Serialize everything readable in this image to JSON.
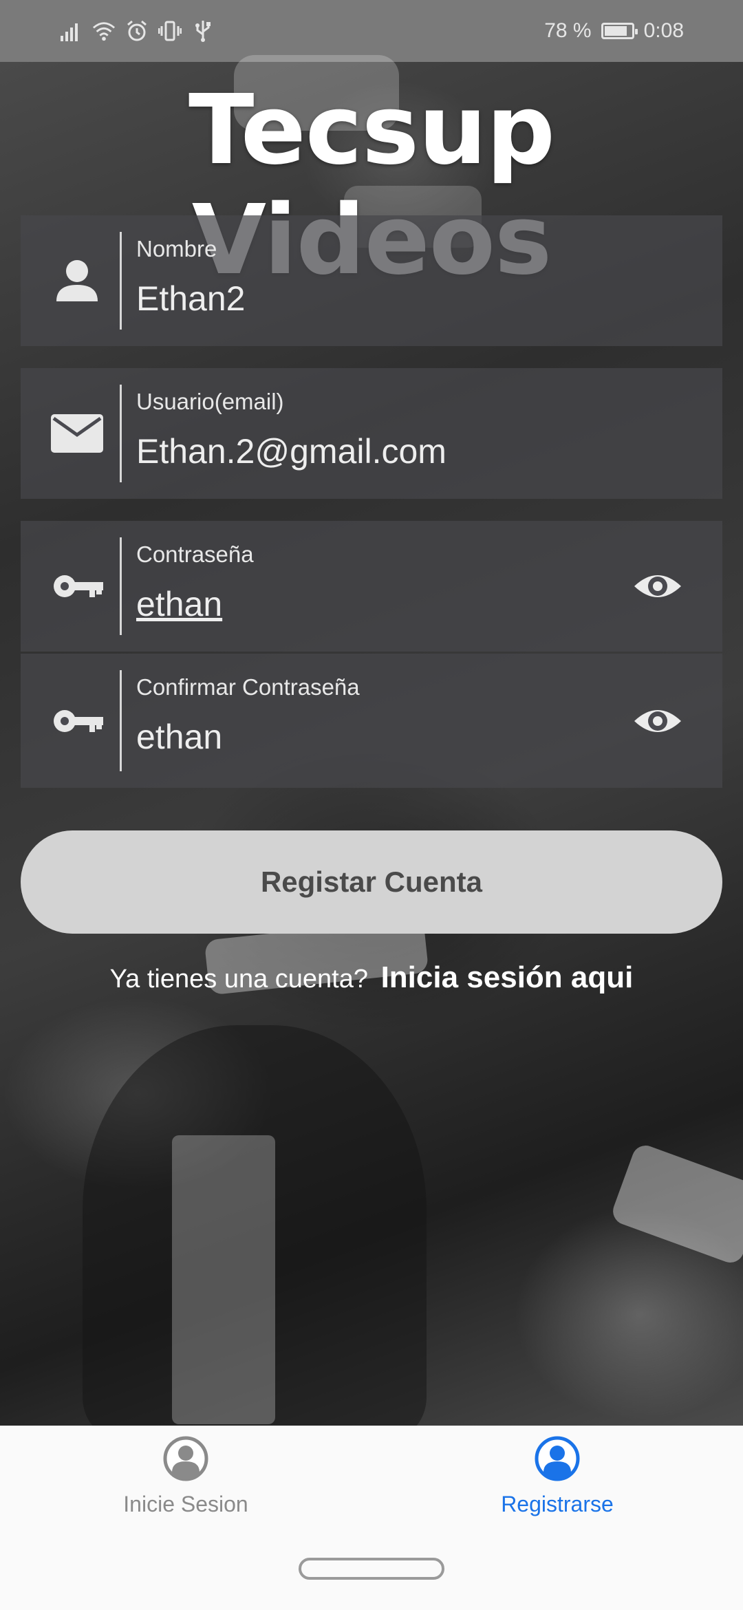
{
  "status_bar": {
    "battery_text": "78 %",
    "time": "0:08",
    "icons": [
      "signal-icon",
      "wifi-icon",
      "alarm-icon",
      "vibrate-icon",
      "usb-icon",
      "battery-icon"
    ]
  },
  "app": {
    "title": "Tecsup Videos"
  },
  "form": {
    "name": {
      "label": "Nombre",
      "value": "Ethan2",
      "icon": "person-icon"
    },
    "email": {
      "label": "Usuario(email)",
      "value": "Ethan.2@gmail.com",
      "icon": "mail-icon"
    },
    "password": {
      "label": "Contraseña",
      "value": "ethan",
      "icon": "key-icon"
    },
    "confirm_password": {
      "label": "Confirmar Contraseña",
      "value": "ethan",
      "icon": "key-icon"
    }
  },
  "register_button": {
    "label": "Registar Cuenta"
  },
  "login_prompt": {
    "text": "Ya tienes una cuenta?",
    "link": "Inicia sesión aqui"
  },
  "bottom_nav": {
    "items": [
      {
        "label": "Inicie Sesion",
        "active": false,
        "icon": "account-circle-icon"
      },
      {
        "label": "Registrarse",
        "active": true,
        "icon": "account-circle-icon"
      }
    ]
  },
  "colors": {
    "accent": "#1a73e8",
    "status_bar": "#7a7a7a",
    "button": "#d3d3d3",
    "nav_inactive": "#8a8a8a"
  }
}
